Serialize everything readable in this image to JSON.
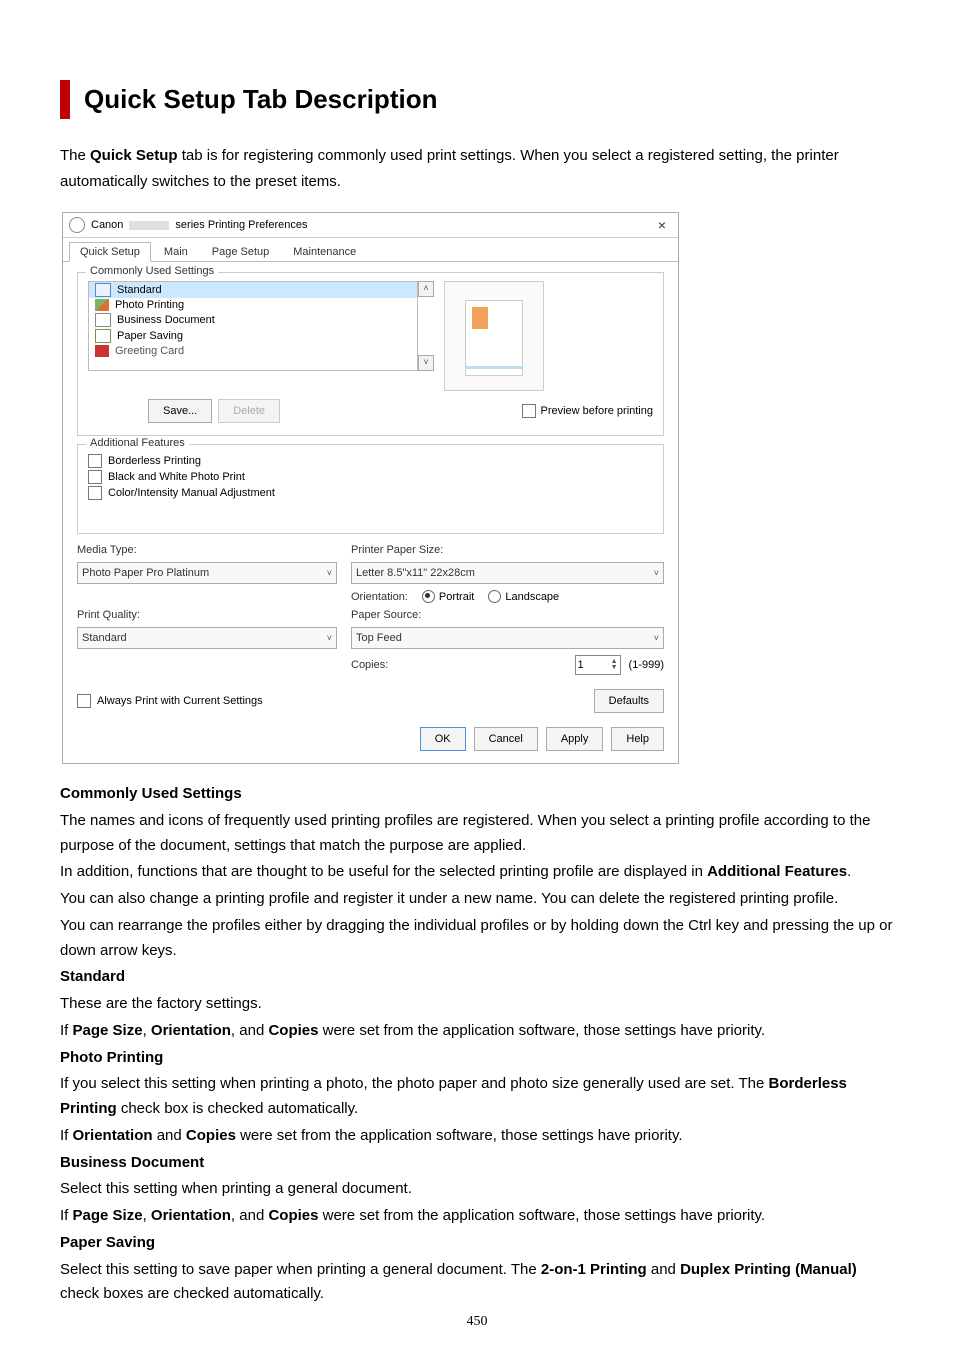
{
  "page_number": "450",
  "title": "Quick Setup Tab Description",
  "intro": {
    "prefix": "The ",
    "bold": "Quick Setup",
    "suffix": " tab is for registering commonly used print settings. When you select a registered setting, the printer automatically switches to the preset items."
  },
  "dialog": {
    "window_title_prefix": "Canon",
    "window_title_suffix": "series Printing Preferences",
    "close_label": "×",
    "tabs": [
      "Quick Setup",
      "Main",
      "Page Setup",
      "Maintenance"
    ],
    "active_tab_index": 0,
    "commonly_used_label": "Commonly Used Settings",
    "profiles": [
      "Standard",
      "Photo Printing",
      "Business Document",
      "Paper Saving",
      "Greeting Card"
    ],
    "selected_profile_index": 0,
    "save_label": "Save...",
    "delete_label": "Delete",
    "preview_before_label": "Preview before printing",
    "additional_features_label": "Additional Features",
    "additional_features": [
      "Borderless Printing",
      "Black and White Photo Print",
      "Color/Intensity Manual Adjustment"
    ],
    "media_type_label": "Media Type:",
    "media_type_value": "Photo Paper Pro Platinum",
    "printer_paper_size_label": "Printer Paper Size:",
    "printer_paper_size_value": "Letter 8.5\"x11\" 22x28cm",
    "orientation_label": "Orientation:",
    "orientation_portrait": "Portrait",
    "orientation_landscape": "Landscape",
    "print_quality_label": "Print Quality:",
    "print_quality_value": "Standard",
    "paper_source_label": "Paper Source:",
    "paper_source_value": "Top Feed",
    "copies_label": "Copies:",
    "copies_value": "1",
    "copies_range": "(1-999)",
    "always_print_label": "Always Print with Current Settings",
    "defaults_label": "Defaults",
    "ok_label": "OK",
    "cancel_label": "Cancel",
    "apply_label": "Apply",
    "help_label": "Help"
  },
  "sections": {
    "commonly": {
      "heading": "Commonly Used Settings",
      "p1": "The names and icons of frequently used printing profiles are registered. When you select a printing profile according to the purpose of the document, settings that match the purpose are applied.",
      "p2a": "In addition, functions that are thought to be useful for the selected printing profile are displayed in ",
      "p2b": "Additional Features",
      "p2c": ".",
      "p3": "You can also change a printing profile and register it under a new name. You can delete the registered printing profile.",
      "p4": "You can rearrange the profiles either by dragging the individual profiles or by holding down the Ctrl key and pressing the up or down arrow keys."
    },
    "standard": {
      "heading": "Standard",
      "p1": "These are the factory settings.",
      "p2a": "If ",
      "p2b": "Page Size",
      "p2c": ", ",
      "p2d": "Orientation",
      "p2e": ", and ",
      "p2f": "Copies",
      "p2g": " were set from the application software, those settings have priority."
    },
    "photo": {
      "heading": "Photo Printing",
      "p1a": "If you select this setting when printing a photo, the photo paper and photo size generally used are set. The ",
      "p1b": "Borderless Printing",
      "p1c": " check box is checked automatically.",
      "p2a": "If ",
      "p2b": "Orientation",
      "p2c": " and ",
      "p2d": "Copies",
      "p2e": " were set from the application software, those settings have priority."
    },
    "business": {
      "heading": "Business Document",
      "p1": "Select this setting when printing a general document.",
      "p2a": "If ",
      "p2b": "Page Size",
      "p2c": ", ",
      "p2d": "Orientation",
      "p2e": ", and ",
      "p2f": "Copies",
      "p2g": " were set from the application software, those settings have priority."
    },
    "papersave": {
      "heading": "Paper Saving",
      "p1a": "Select this setting to save paper when printing a general document. The ",
      "p1b": "2-on-1 Printing",
      "p1c": " and ",
      "p1d": "Duplex Printing (Manual)",
      "p1e": " check boxes are checked automatically."
    }
  }
}
